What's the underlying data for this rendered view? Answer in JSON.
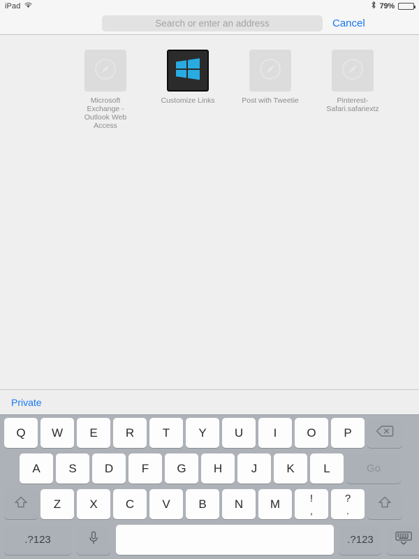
{
  "status_bar": {
    "device_name": "iPad",
    "wifi_icon": "wifi-icon",
    "bluetooth_icon": "bluetooth-icon",
    "battery_percent": "79%",
    "battery_level": 79,
    "battery_icon": "battery-icon"
  },
  "toolbar": {
    "address_placeholder": "Search or enter an address",
    "address_value": "",
    "cancel_label": "Cancel"
  },
  "bookmarks": [
    {
      "label": "Microsoft Exchange - Outlook Web Access",
      "icon": "safari-compass-icon",
      "style": "placeholder"
    },
    {
      "label": "Customize Links",
      "icon": "windows-logo-icon",
      "style": "dark"
    },
    {
      "label": "Post with Tweetie",
      "icon": "safari-compass-icon",
      "style": "placeholder"
    },
    {
      "label": "Pinterest-Safari.safariextz",
      "icon": "safari-compass-icon",
      "style": "placeholder"
    }
  ],
  "private_bar": {
    "private_label": "Private"
  },
  "keyboard": {
    "row1": [
      "Q",
      "W",
      "E",
      "R",
      "T",
      "Y",
      "U",
      "I",
      "O",
      "P"
    ],
    "row2": [
      "A",
      "S",
      "D",
      "F",
      "G",
      "H",
      "J",
      "K",
      "L"
    ],
    "row3": [
      "Z",
      "X",
      "C",
      "V",
      "B",
      "N",
      "M"
    ],
    "row3_dual": [
      {
        "top": "!",
        "bot": ","
      },
      {
        "top": "?",
        "bot": "."
      }
    ],
    "backspace_icon": "backspace-icon",
    "go_label": "Go",
    "shift_icon": "shift-icon",
    "numeric_label": ".?123",
    "mic_icon": "microphone-icon",
    "space_label": "",
    "hide_keyboard_icon": "hide-keyboard-icon"
  },
  "colors": {
    "accent_blue": "#1778f2",
    "keyboard_bg": "#adb1b8",
    "key_white": "#fdfdfd",
    "content_bg": "#efefef",
    "windows_blue": "#29abe2"
  }
}
